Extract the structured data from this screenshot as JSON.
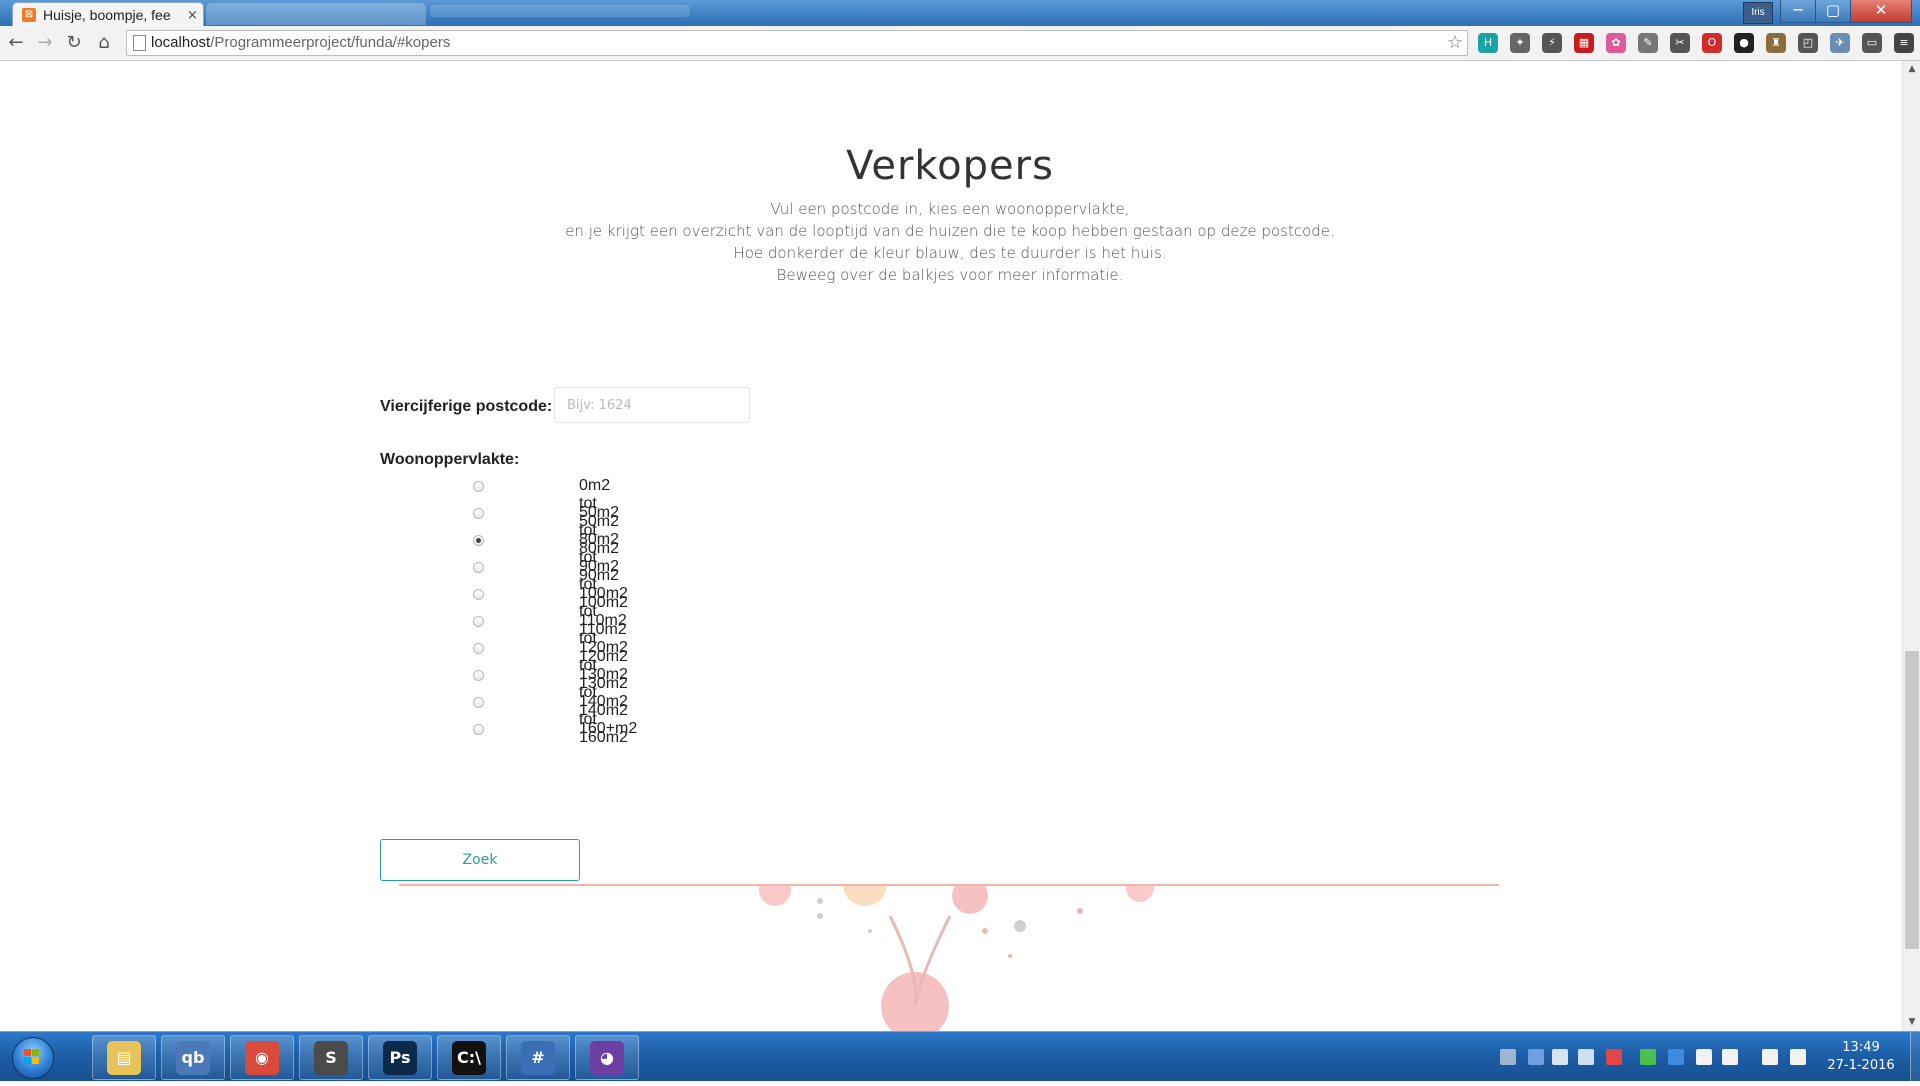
{
  "browser": {
    "tab_title": "Huisje, boompje, fee",
    "tab_close": "×",
    "favicon_label": "⊠",
    "user_badge": "Iris",
    "window_buttons": {
      "minimize": "─",
      "maximize": "▢",
      "close": "✕"
    },
    "nav": {
      "back": "←",
      "forward": "→",
      "reload": "↻",
      "home": "⌂"
    },
    "url_host": "localhost",
    "url_path": "/Programmeerproject/funda/#kopers",
    "star": "☆",
    "extensions": [
      {
        "name": "h-extension-icon",
        "glyph": "H",
        "color": "#1aa3a3"
      },
      {
        "name": "puzzle-extension-icon",
        "glyph": "✦",
        "color": "#666"
      },
      {
        "name": "ext-3-icon",
        "glyph": "⚡",
        "color": "#555"
      },
      {
        "name": "ext-red-icon",
        "glyph": "▦",
        "color": "#c81c1c"
      },
      {
        "name": "color-wheel-icon",
        "glyph": "✿",
        "color": "#e05a9a"
      },
      {
        "name": "eyedropper-icon",
        "glyph": "✎",
        "color": "#777"
      },
      {
        "name": "tool-icon",
        "glyph": "✂",
        "color": "#555"
      },
      {
        "name": "opera-icon",
        "glyph": "O",
        "color": "#d12b2b"
      },
      {
        "name": "camera-icon",
        "glyph": "●",
        "color": "#222"
      },
      {
        "name": "castle-icon",
        "glyph": "♜",
        "color": "#8a6d3b"
      },
      {
        "name": "ext-11-icon",
        "glyph": "◰",
        "color": "#555"
      },
      {
        "name": "ext-12-icon",
        "glyph": "✈",
        "color": "#6a8fb3"
      },
      {
        "name": "cast-icon",
        "glyph": "▭",
        "color": "#555"
      },
      {
        "name": "menu-icon",
        "glyph": "≡",
        "color": "#444"
      }
    ]
  },
  "page": {
    "heading": "Verkopers",
    "intro_lines": [
      "Vul een postcode in, kies een woonoppervlakte,",
      "en je krijgt een overzicht van de looptijd van de huizen die te koop hebben gestaan op deze postcode.",
      "Hoe donkerder de kleur blauw, des te duurder is het huis.",
      "Beweeg over de balkjes voor meer informatie."
    ],
    "postcode_label": "Viercijferige postcode:",
    "postcode_placeholder": "Bijv: 1624",
    "postcode_value": "",
    "area_label": "Woonoppervlakte:",
    "area_options": [
      {
        "label": "0m2 tot 50m2",
        "checked": false
      },
      {
        "label": "50m2 tot 80m2",
        "checked": false
      },
      {
        "label": "80m2 tot 90m2",
        "checked": true
      },
      {
        "label": "90m2 tot 100m2",
        "checked": false
      },
      {
        "label": "100m2 tot 110m2",
        "checked": false
      },
      {
        "label": "110m2 tot 120m2",
        "checked": false
      },
      {
        "label": "120m2 tot 130m2",
        "checked": false
      },
      {
        "label": "130m2 tot 140m2",
        "checked": false
      },
      {
        "label": "140m2 tot 160m2",
        "checked": false
      },
      {
        "label": "160+m2",
        "checked": false
      }
    ],
    "search_button": "Zoek",
    "accent_color": "#26a0a6",
    "divider_color": "#f3b5a8"
  },
  "taskbar": {
    "apps": [
      {
        "name": "explorer-taskbar-icon",
        "glyph": "▤",
        "color": "#e8c35a"
      },
      {
        "name": "qbittorrent-taskbar-icon",
        "glyph": "qb",
        "color": "#4a78b8"
      },
      {
        "name": "chrome-taskbar-icon",
        "glyph": "◉",
        "color": "#d94a3a"
      },
      {
        "name": "sublime-taskbar-icon",
        "glyph": "S",
        "color": "#4b4b4b"
      },
      {
        "name": "photoshop-taskbar-icon",
        "glyph": "Ps",
        "color": "#0b2a4a"
      },
      {
        "name": "cmd-taskbar-icon",
        "glyph": "C:\\",
        "color": "#111"
      },
      {
        "name": "csharp-taskbar-icon",
        "glyph": "#",
        "color": "#3b6fb5"
      },
      {
        "name": "github-taskbar-icon",
        "glyph": "◕",
        "color": "#6e3fa3"
      }
    ],
    "time": "13:49",
    "date": "27-1-2016"
  }
}
